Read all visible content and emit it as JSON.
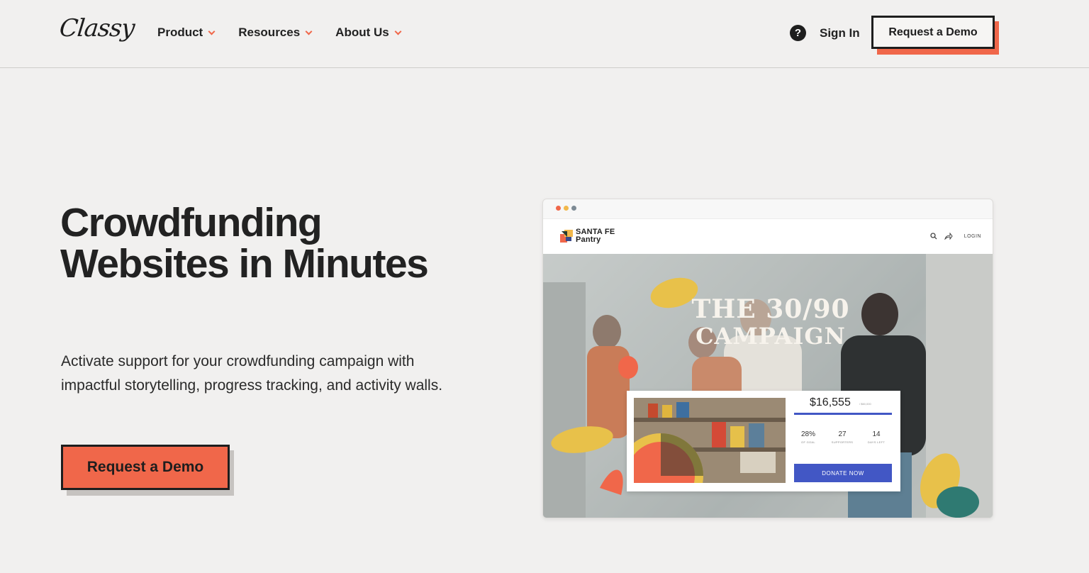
{
  "header": {
    "logo": "Classy",
    "nav": [
      {
        "label": "Product"
      },
      {
        "label": "Resources"
      },
      {
        "label": "About Us"
      }
    ],
    "help": "?",
    "sign_in": "Sign In",
    "cta": "Request a Demo"
  },
  "hero": {
    "title": "Crowdfunding Websites in Minutes",
    "subtitle": "Activate support for your crowdfunding campaign with impactful storytelling, progress tracking, and activity walls.",
    "cta": "Request a Demo"
  },
  "mockup": {
    "org_name_line1": "SANTA FE",
    "org_name_line2": "Pantry",
    "login": "LOGIN",
    "campaign_line1": "THE 30/90",
    "campaign_line2": "CAMPAIGN",
    "amount": "$16,555",
    "goal": "/ $60,000",
    "progress": 0.28,
    "stats": [
      {
        "value": "28%",
        "label": "OF GOAL"
      },
      {
        "value": "27",
        "label": "SUPPORTERS"
      },
      {
        "value": "14",
        "label": "DAYS LEFT"
      }
    ],
    "donate": "DONATE NOW"
  },
  "colors": {
    "accent": "#f0674a",
    "background": "#f1f0ef",
    "dark": "#1e1e1e",
    "donate_blue": "#4257c5",
    "dot_red": "#f0674a",
    "dot_yellow": "#f2b84b",
    "dot_gray": "#7d8a94"
  }
}
